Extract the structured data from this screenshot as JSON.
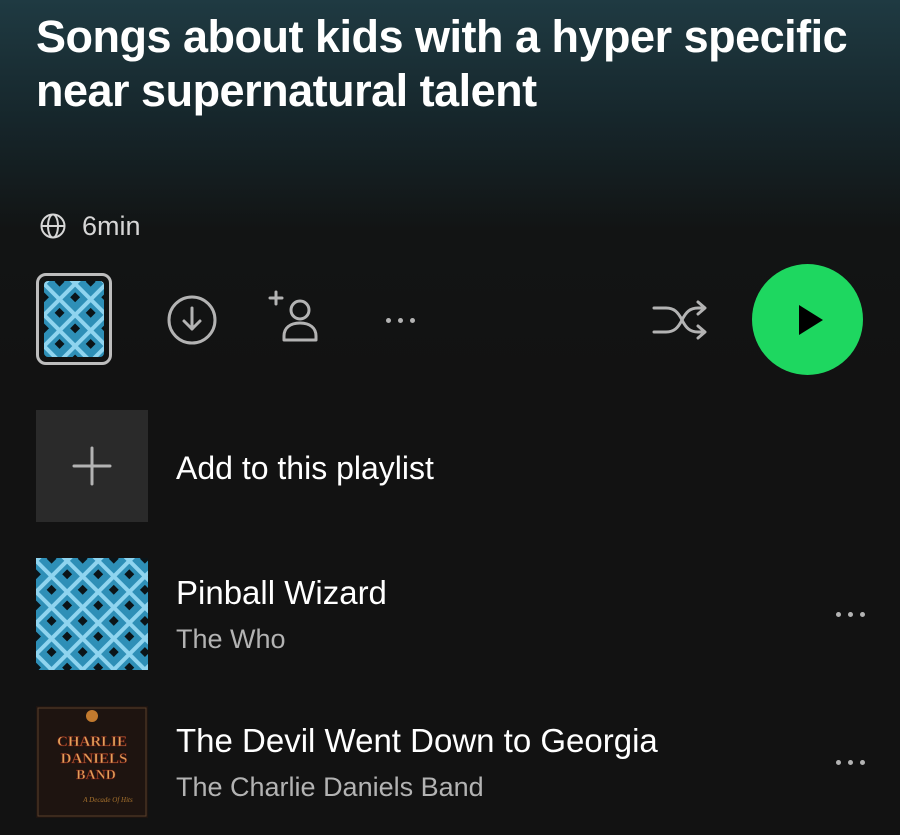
{
  "playlist": {
    "title": "Songs about kids with a hyper specific near supernatural talent",
    "duration": "6min"
  },
  "icons": {
    "globe": "globe-icon",
    "download": "download-icon",
    "add_user": "add-collaborator-icon",
    "more": "more-options-icon",
    "shuffle": "shuffle-icon",
    "play": "play-icon",
    "plus": "plus-icon"
  },
  "colors": {
    "accent": "#1ed760",
    "background": "#121212",
    "header_tint": "#1f3a42",
    "secondary_text": "#b3b3b3"
  },
  "add_row": {
    "label": "Add to this playlist"
  },
  "tracks": [
    {
      "title": "Pinball Wizard",
      "artist": "The Who"
    },
    {
      "title": "The Devil Went Down to Georgia",
      "artist": "The Charlie Daniels Band"
    }
  ],
  "album_art": {
    "charlie_daniels": {
      "line1": "CHARLIE",
      "line2": "DANIELS",
      "line3": "BAND",
      "subtitle": "A Decade Of Hits"
    }
  }
}
